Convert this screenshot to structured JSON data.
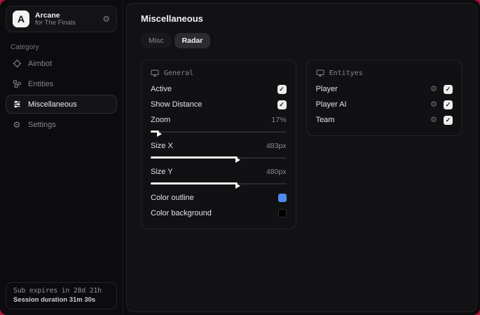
{
  "app": {
    "name": "Arcane",
    "subtitle": "for The Finals",
    "logo_letter": "A"
  },
  "sidebar": {
    "category_label": "Category",
    "items": [
      {
        "label": "Aimbot"
      },
      {
        "label": "Entities"
      },
      {
        "label": "Miscellaneous"
      },
      {
        "label": "Settings"
      }
    ],
    "footer": {
      "line1": "Sub expires in 28d 21h",
      "line2": "Session duration 31m 30s"
    }
  },
  "main": {
    "title": "Miscellaneous",
    "tabs": [
      {
        "label": "Misc",
        "active": false
      },
      {
        "label": "Radar",
        "active": true
      }
    ],
    "general_panel": {
      "title": "General",
      "toggles": [
        {
          "label": "Active",
          "checked": true
        },
        {
          "label": "Show Distance",
          "checked": true
        }
      ],
      "sliders": [
        {
          "label": "Zoom",
          "value": "17%",
          "fill_percent": 6
        },
        {
          "label": "Size X",
          "value": "483px",
          "fill_percent": 64
        },
        {
          "label": "Size Y",
          "value": "480px",
          "fill_percent": 64
        }
      ],
      "colors": [
        {
          "label": "Color outline",
          "color": "#4d8bf0"
        },
        {
          "label": "Color background",
          "color": "#000000"
        }
      ]
    },
    "entities_panel": {
      "title": "Entityes",
      "items": [
        {
          "label": "Player",
          "checked": true
        },
        {
          "label": "Player AI",
          "checked": true
        },
        {
          "label": "Team",
          "checked": true
        }
      ]
    }
  },
  "colors": {
    "accent_blue": "#4d8bf0",
    "desktop_background": "#b5123b"
  }
}
